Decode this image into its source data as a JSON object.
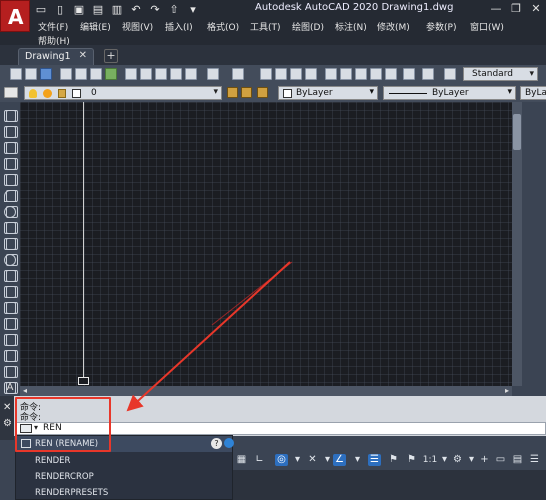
{
  "app": {
    "logo_letter": "A",
    "window_title": "Autodesk AutoCAD 2020    Drawing1.dwg",
    "window_buttons": [
      "—",
      "❐",
      "✕"
    ]
  },
  "menu": {
    "items": [
      "文件(F)",
      "编辑(E)",
      "视图(V)",
      "插入(I)",
      "格式(O)",
      "工具(T)",
      "绘图(D)",
      "标注(N)",
      "修改(M)",
      "参数(P)",
      "窗口(W)"
    ],
    "help": "帮助(H)"
  },
  "tabs": {
    "doc_tab": "Drawing1",
    "close": "✕",
    "new_tab": "+"
  },
  "toolbar": {
    "text_style": "Standard"
  },
  "layers": {
    "current_layer": "0",
    "color": "ByLayer",
    "linetype": "ByLayer",
    "lineweight": "ByLa"
  },
  "command": {
    "history": [
      "命令:",
      "命令:"
    ],
    "input_value": "REN",
    "close_icon": "✕",
    "settings_icon": "🔧"
  },
  "suggestions": {
    "items": [
      "REN (RENAME)",
      "RENDER",
      "RENDERCROP",
      "RENDERPRESETS"
    ],
    "help_icon": "?"
  },
  "statusbar": {
    "scale": "1:1"
  },
  "colors": {
    "annotation_red": "#e8372a",
    "canvas_bg": "#1b1d22",
    "ui_dark": "#3b4453"
  }
}
